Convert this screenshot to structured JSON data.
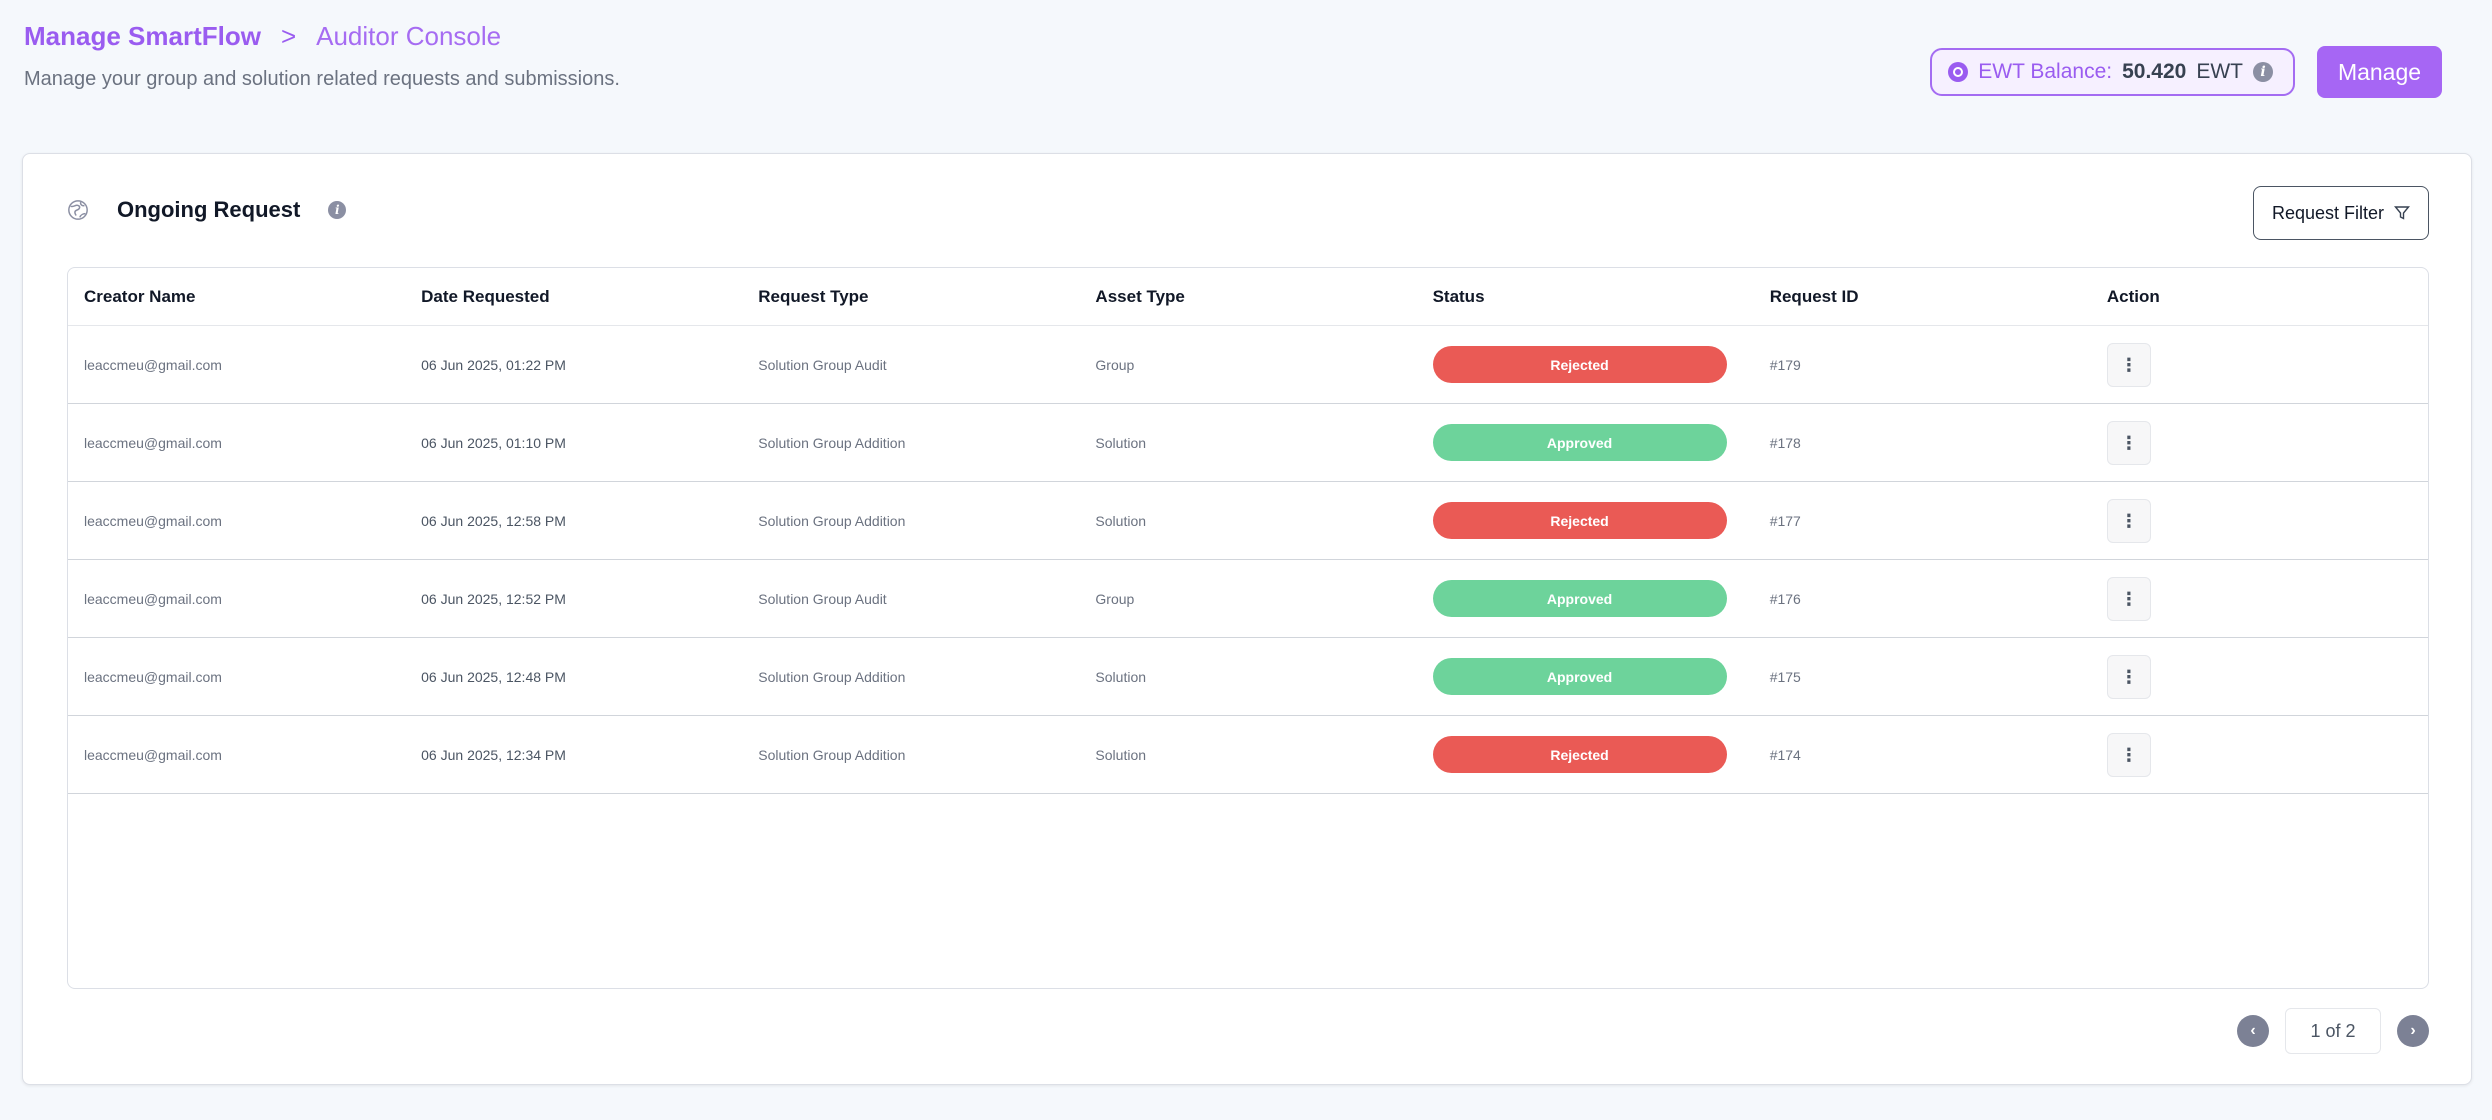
{
  "header": {
    "breadcrumb_main": "Manage SmartFlow",
    "breadcrumb_sep": ">",
    "breadcrumb_current": "Auditor Console",
    "subtitle": "Manage your group and solution related requests and submissions."
  },
  "balance": {
    "icon": "coin-icon",
    "label": "EWT Balance:",
    "value": "50.420",
    "unit": "EWT",
    "info_icon": "info-icon"
  },
  "manage_button": {
    "label": "Manage"
  },
  "card": {
    "icon": "globe-icon",
    "title": "Ongoing Request",
    "filter_label": "Request Filter",
    "filter_icon": "filter-icon"
  },
  "table": {
    "columns": [
      "Creator Name",
      "Date Requested",
      "Request Type",
      "Asset Type",
      "Status",
      "Request ID",
      "Action"
    ],
    "rows": [
      {
        "creator": "leaccmeu@gmail.com",
        "date": "06 Jun 2025, 01:22 PM",
        "type": "Solution Group Audit",
        "asset": "Group",
        "status": "Rejected",
        "id": "#179"
      },
      {
        "creator": "leaccmeu@gmail.com",
        "date": "06 Jun 2025, 01:10 PM",
        "type": "Solution Group Addition",
        "asset": "Solution",
        "status": "Approved",
        "id": "#178"
      },
      {
        "creator": "leaccmeu@gmail.com",
        "date": "06 Jun 2025, 12:58 PM",
        "type": "Solution Group Addition",
        "asset": "Solution",
        "status": "Rejected",
        "id": "#177"
      },
      {
        "creator": "leaccmeu@gmail.com",
        "date": "06 Jun 2025, 12:52 PM",
        "type": "Solution Group Audit",
        "asset": "Group",
        "status": "Approved",
        "id": "#176"
      },
      {
        "creator": "leaccmeu@gmail.com",
        "date": "06 Jun 2025, 12:48 PM",
        "type": "Solution Group Addition",
        "asset": "Solution",
        "status": "Approved",
        "id": "#175"
      },
      {
        "creator": "leaccmeu@gmail.com",
        "date": "06 Jun 2025, 12:34 PM",
        "type": "Solution Group Addition",
        "asset": "Solution",
        "status": "Rejected",
        "id": "#174"
      }
    ],
    "action_glyph": "⋮"
  },
  "pagination": {
    "prev_glyph": "‹",
    "next_glyph": "›",
    "indicator": "1 of 2"
  },
  "colors": {
    "accent": "#a666f4",
    "rejected": "#ea5a55",
    "approved": "#6dd39b"
  }
}
